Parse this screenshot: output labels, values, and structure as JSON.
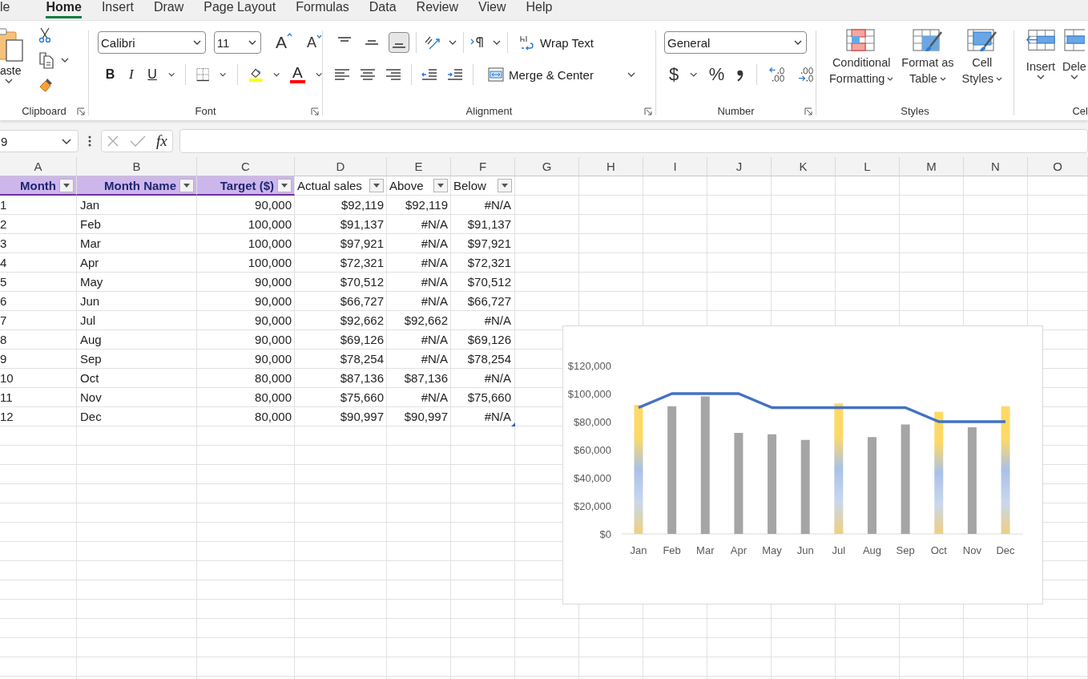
{
  "menu_tabs": [
    {
      "label": "le",
      "selected": false
    },
    {
      "label": "Home",
      "selected": true
    },
    {
      "label": "Insert",
      "selected": false
    },
    {
      "label": "Draw",
      "selected": false
    },
    {
      "label": "Page Layout",
      "selected": false
    },
    {
      "label": "Formulas",
      "selected": false
    },
    {
      "label": "Data",
      "selected": false
    },
    {
      "label": "Review",
      "selected": false
    },
    {
      "label": "View",
      "selected": false
    },
    {
      "label": "Help",
      "selected": false
    }
  ],
  "ribbon": {
    "clipboard": {
      "paste": "aste",
      "group": "Clipboard"
    },
    "font": {
      "name": "Calibri",
      "size": "11",
      "grow": "A",
      "shrink": "A",
      "bold": "B",
      "italic": "I",
      "underline": "U",
      "font_color": "A",
      "group": "Font"
    },
    "alignment": {
      "vertical_align": [
        {
          "selected": false
        },
        {
          "selected": false
        },
        {
          "selected": true
        }
      ],
      "wrap_text": "Wrap Text",
      "merge_center": "Merge & Center",
      "group": "Alignment"
    },
    "number": {
      "format": "General",
      "currency": "$",
      "percent": "%",
      "group": "Number"
    },
    "styles": {
      "buttons": [
        {
          "lines": [
            "Conditional",
            "Formatting"
          ]
        },
        {
          "lines": [
            "Format as",
            "Table"
          ]
        },
        {
          "lines": [
            "Cell",
            "Styles"
          ]
        }
      ],
      "group": "Styles"
    },
    "cells": {
      "insert": "Insert",
      "delete": "Dele",
      "group": "Cel"
    }
  },
  "formula_bar": {
    "name_box": "9",
    "fx": "fx"
  },
  "columns": [
    "A",
    "B",
    "C",
    "D",
    "E",
    "F",
    "G",
    "H",
    "I",
    "J",
    "K",
    "L",
    "M",
    "N",
    "O"
  ],
  "table": {
    "headers": [
      {
        "label": "Month",
        "highlighted": true
      },
      {
        "label": "Month Name",
        "highlighted": true
      },
      {
        "label": "Target ($)",
        "highlighted": true
      },
      {
        "label": "Actual sales",
        "highlighted": false
      },
      {
        "label": "Above",
        "highlighted": false
      },
      {
        "label": "Below",
        "highlighted": false
      }
    ],
    "rows": [
      [
        "1",
        "Jan",
        "90,000",
        "$92,119",
        "$92,119",
        "#N/A"
      ],
      [
        "2",
        "Feb",
        "100,000",
        "$91,137",
        "#N/A",
        "$91,137"
      ],
      [
        "3",
        "Mar",
        "100,000",
        "$97,921",
        "#N/A",
        "$97,921"
      ],
      [
        "4",
        "Apr",
        "100,000",
        "$72,321",
        "#N/A",
        "$72,321"
      ],
      [
        "5",
        "May",
        "90,000",
        "$70,512",
        "#N/A",
        "$70,512"
      ],
      [
        "6",
        "Jun",
        "90,000",
        "$66,727",
        "#N/A",
        "$66,727"
      ],
      [
        "7",
        "Jul",
        "90,000",
        "$92,662",
        "$92,662",
        "#N/A"
      ],
      [
        "8",
        "Aug",
        "90,000",
        "$69,126",
        "#N/A",
        "$69,126"
      ],
      [
        "9",
        "Sep",
        "90,000",
        "$78,254",
        "#N/A",
        "$78,254"
      ],
      [
        "10",
        "Oct",
        "80,000",
        "$87,136",
        "$87,136",
        "#N/A"
      ],
      [
        "11",
        "Nov",
        "80,000",
        "$75,660",
        "#N/A",
        "$75,660"
      ],
      [
        "12",
        "Dec",
        "80,000",
        "$90,997",
        "$90,997",
        "#N/A"
      ]
    ]
  },
  "chart": {
    "chart_data": {
      "type": "bar",
      "categories": [
        "Jan",
        "Feb",
        "Mar",
        "Apr",
        "May",
        "Jun",
        "Jul",
        "Aug",
        "Sep",
        "Oct",
        "Nov",
        "Dec"
      ],
      "ylim": [
        0,
        120000
      ],
      "yticks": [
        {
          "value": 0,
          "label": "$0"
        },
        {
          "value": 20000,
          "label": "$20,000"
        },
        {
          "value": 40000,
          "label": "$40,000"
        },
        {
          "value": 60000,
          "label": "$60,000"
        },
        {
          "value": 80000,
          "label": "$80,000"
        },
        {
          "value": 100000,
          "label": "$100,000"
        },
        {
          "value": 120000,
          "label": "$120,000"
        }
      ],
      "series": [
        {
          "color": "#ffd966",
          "type": "bar",
          "values": [
            92000,
            null,
            null,
            null,
            null,
            null,
            93000,
            null,
            null,
            87000,
            null,
            91000
          ]
        },
        {
          "color": "#a5a5a5",
          "type": "bar",
          "values": [
            null,
            91000,
            98000,
            72000,
            71000,
            67000,
            null,
            69000,
            78000,
            null,
            76000,
            null
          ]
        },
        {
          "color": "#4472c4",
          "type": "line",
          "values": [
            90000,
            100000,
            100000,
            100000,
            90000,
            90000,
            90000,
            90000,
            90000,
            80000,
            80000,
            80000
          ]
        }
      ]
    }
  }
}
